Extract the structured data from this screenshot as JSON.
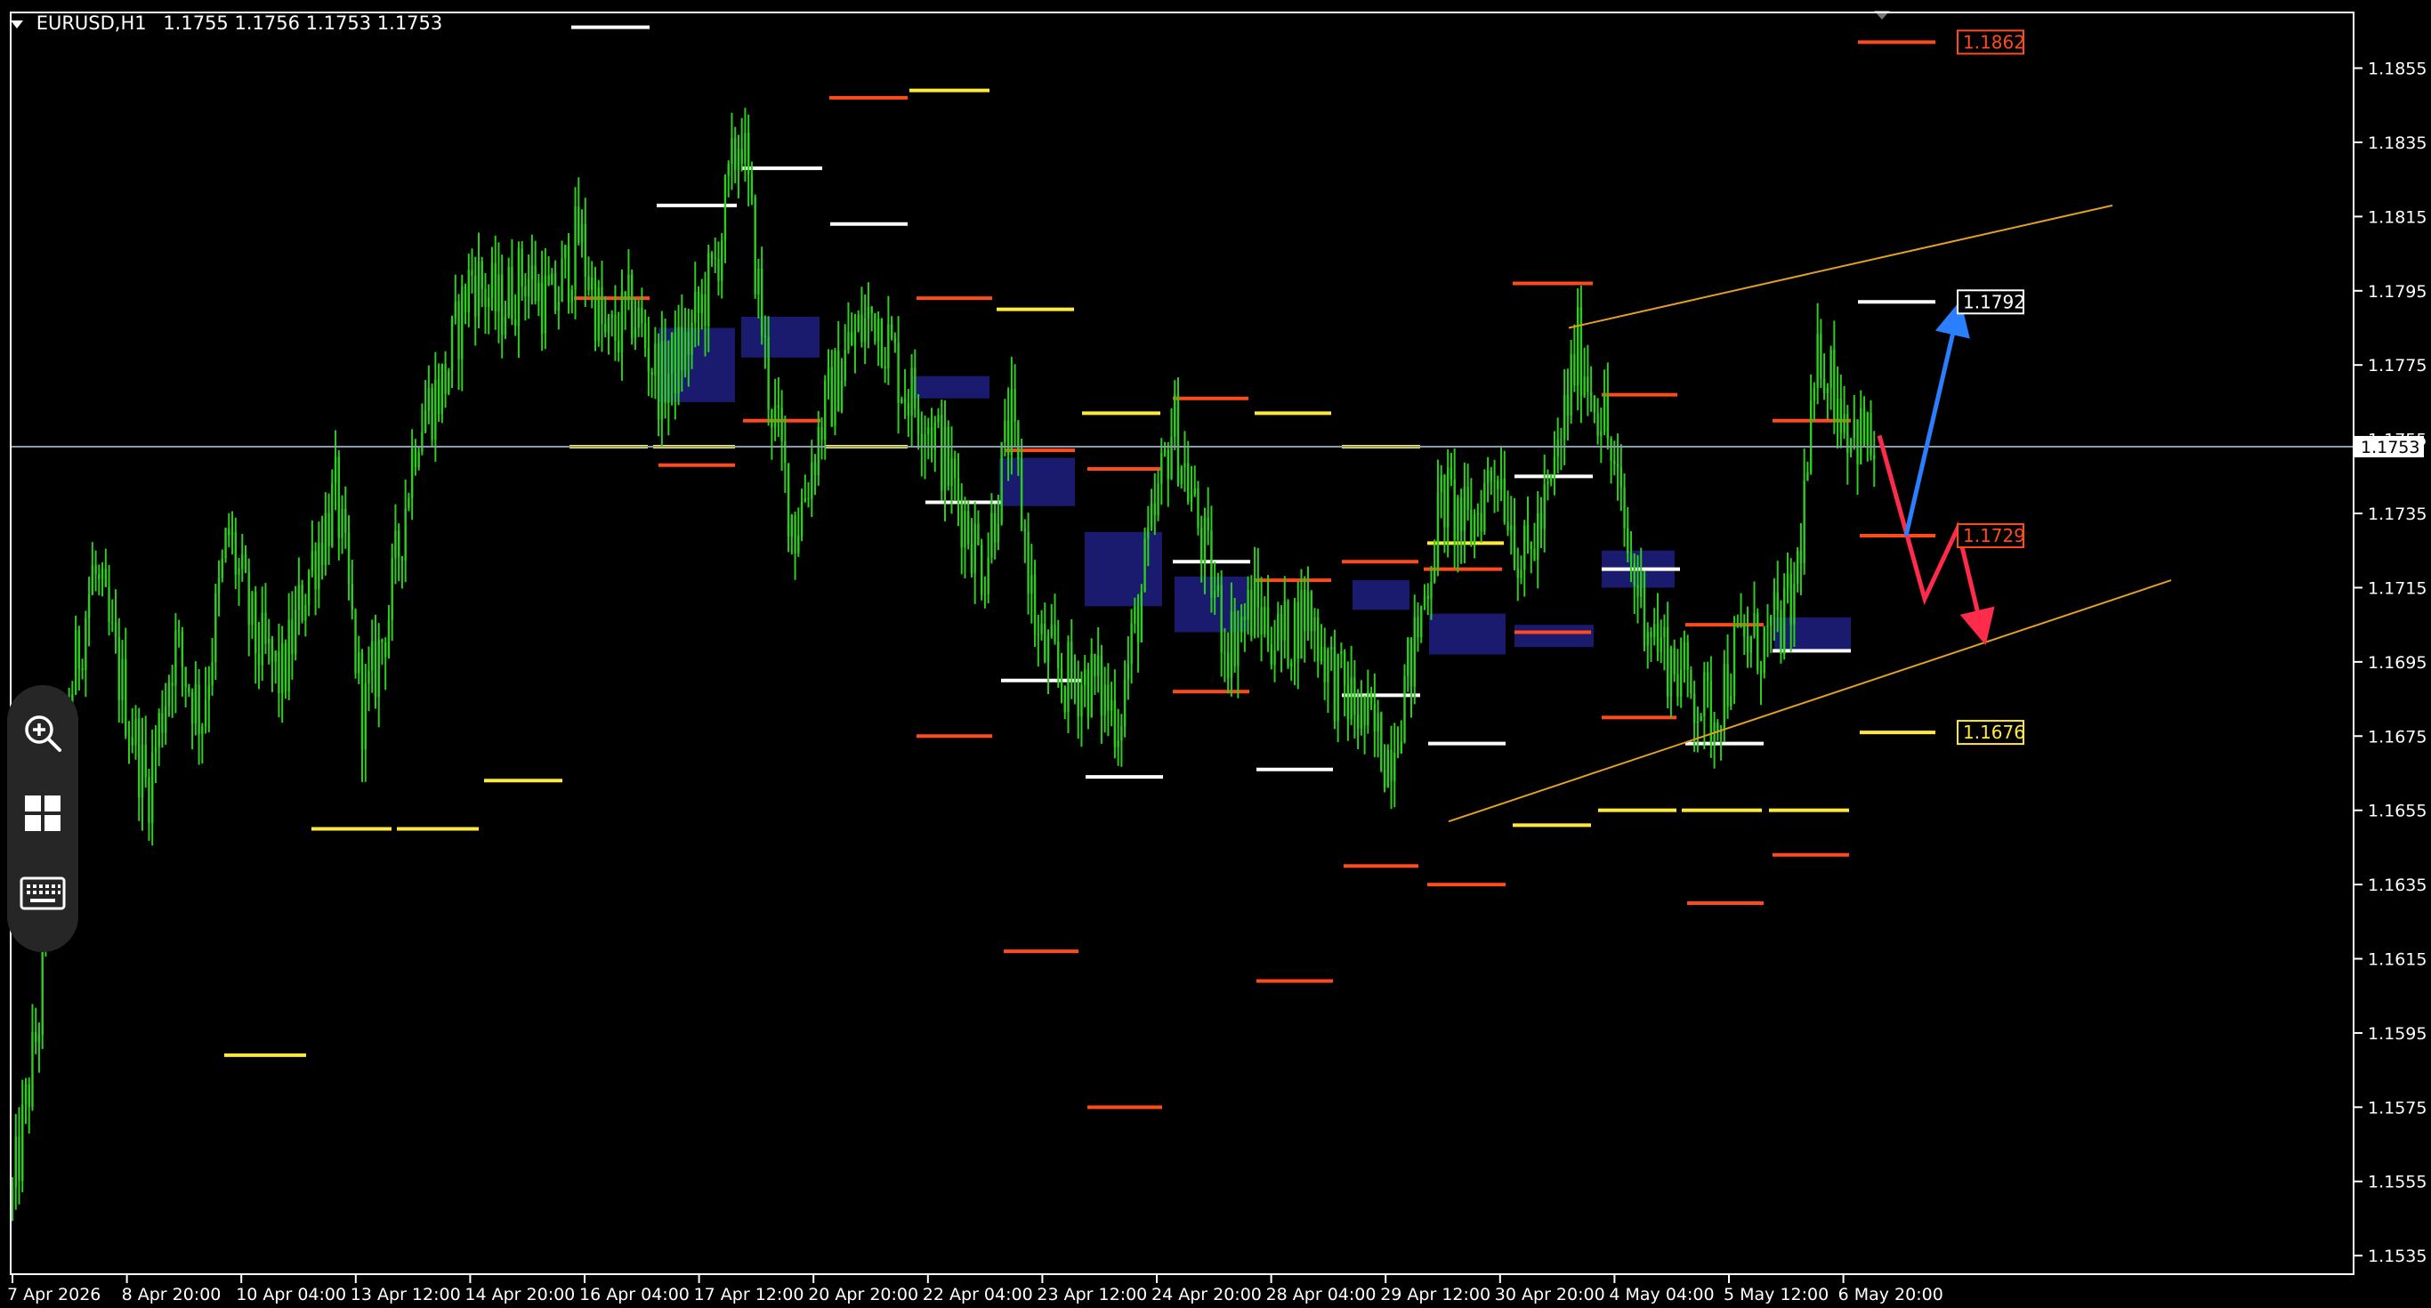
{
  "header": {
    "symbol": "EURUSD,H1",
    "ohlc": "1.1755 1.1756 1.1753 1.1753"
  },
  "toolbar": {
    "items": [
      {
        "name": "zoom-in-icon"
      },
      {
        "name": "windows-icon"
      },
      {
        "name": "keyboard-icon"
      }
    ]
  },
  "colors": {
    "background": "#000000",
    "candles": "#2ecc1f",
    "axis": "#ffffff",
    "current_price_line": "#8a9bb0",
    "trendline": "#e0a020",
    "level_white": "#ffffff",
    "level_red": "#ff4a1c",
    "level_yellow": "#ffea3a",
    "zone": "#1a1a6e",
    "arrow_up": "#2a7fff",
    "arrow_down": "#ff2b4a"
  },
  "chart_data": {
    "type": "candlestick",
    "symbol": "EURUSD",
    "timeframe": "H1",
    "ylim": [
      1.153,
      1.187
    ],
    "y_ticks": [
      "1.1855",
      "1.1835",
      "1.1815",
      "1.1795",
      "1.1775",
      "1.1755",
      "1.1735",
      "1.1715",
      "1.1695",
      "1.1675",
      "1.1655",
      "1.1635",
      "1.1615",
      "1.1595",
      "1.1575",
      "1.1555",
      "1.1535"
    ],
    "x_ticks": [
      "7 Apr 2026",
      "8 Apr 20:00",
      "10 Apr 04:00",
      "13 Apr 12:00",
      "14 Apr 20:00",
      "16 Apr 04:00",
      "17 Apr 12:00",
      "20 Apr 20:00",
      "22 Apr 04:00",
      "23 Apr 12:00",
      "24 Apr 20:00",
      "28 Apr 04:00",
      "29 Apr 12:00",
      "30 Apr 20:00",
      "4 May 04:00",
      "5 May 12:00",
      "6 May 20:00"
    ],
    "current_price": "1.1753",
    "price_path": [
      1.155,
      1.16,
      1.168,
      1.172,
      1.169,
      1.166,
      1.17,
      1.168,
      1.173,
      1.17,
      1.169,
      1.172,
      1.174,
      1.168,
      1.171,
      1.176,
      1.177,
      1.18,
      1.179,
      1.18,
      1.179,
      1.181,
      1.178,
      1.179,
      1.177,
      1.178,
      1.18,
      1.184,
      1.177,
      1.173,
      1.176,
      1.178,
      1.179,
      1.177,
      1.176,
      1.174,
      1.172,
      1.176,
      1.17,
      1.169,
      1.169,
      1.168,
      1.172,
      1.176,
      1.173,
      1.17,
      1.171,
      1.17,
      1.171,
      1.169,
      1.168,
      1.167,
      1.17,
      1.174,
      1.173,
      1.175,
      1.172,
      1.174,
      1.178,
      1.176,
      1.172,
      1.17,
      1.169,
      1.168,
      1.17,
      1.17,
      1.171,
      1.178,
      1.176,
      1.1752
    ],
    "annotations": [
      {
        "label": "1.1862",
        "color": "red"
      },
      {
        "label": "1.1792",
        "color": "white"
      },
      {
        "label": "1.1729",
        "color": "red"
      },
      {
        "label": "1.1676",
        "color": "yellow"
      }
    ]
  }
}
